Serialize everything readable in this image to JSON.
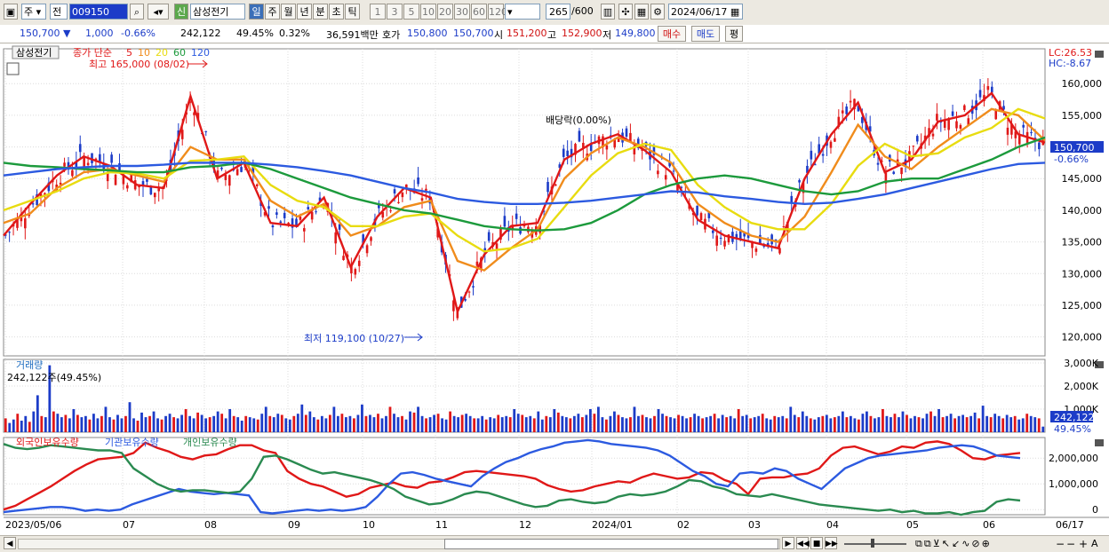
{
  "toolbar": {
    "period_type": "주",
    "prev_label": "전",
    "code": "009150",
    "stock_name": "삼성전기",
    "new_badge": "신",
    "periods": [
      "일",
      "주",
      "월",
      "년",
      "분",
      "초",
      "틱"
    ],
    "active_period": "일",
    "intervals": [
      "1",
      "3",
      "5",
      "10",
      "20",
      "30",
      "60",
      "120"
    ],
    "count": "265",
    "count_total": "/600",
    "date": "2024/06/17"
  },
  "info": {
    "price": "150,700",
    "change": "1,000",
    "change_pct": "-0.66%",
    "volume": "242,122",
    "vol_ratio": "49.45%",
    "turnover_rate": "0.32%",
    "amount": "36,591백만",
    "ask_label": "호가",
    "ask1": "150,800",
    "ask2": "150,700",
    "open_label": "시",
    "open": "151,200",
    "high_label": "고",
    "high": "152,900",
    "low_label": "저",
    "low": "149,800",
    "buy_label": "매수",
    "sell_label": "매도",
    "eval_label": "평"
  },
  "price_panel": {
    "stock_tag": "삼성전기",
    "ma_label": "종가 단순",
    "ma_periods": [
      {
        "label": "5",
        "color": "#e01818"
      },
      {
        "label": "10",
        "color": "#f08c1c"
      },
      {
        "label": "20",
        "color": "#e8dc10"
      },
      {
        "label": "60",
        "color": "#1c9a3c"
      },
      {
        "label": "120",
        "color": "#2c5ae0"
      }
    ],
    "high_annot": "최고 165,000 (08/02)",
    "low_annot": "최저 119,100 (10/27)",
    "div_annot": "배당락(0.00%)",
    "lc": "LC:26.53",
    "hc": "HC:-8.67",
    "current_price": "150,700",
    "current_pct": "-0.66%"
  },
  "volume_panel": {
    "title": "거래량",
    "value": "242,122주(49.45%)",
    "current": "242,122",
    "current_pct": "49.45%"
  },
  "holding_panel": {
    "series_labels": [
      "외국인보유수량",
      "기관보유수량",
      "개인보유수량"
    ]
  },
  "chart_data": [
    {
      "type": "candlestick",
      "title": "삼성전기",
      "x_axis_labels": [
        "2023/05/06",
        "07",
        "08",
        "09",
        "10",
        "11",
        "12",
        "2024/01",
        "02",
        "03",
        "04",
        "05",
        "06",
        "06/17"
      ],
      "y_ticks": [
        120000,
        125000,
        130000,
        135000,
        140000,
        145000,
        150000,
        155000,
        160000
      ],
      "ylim": [
        117000,
        165500
      ],
      "series": [
        {
          "name": "5",
          "color": "#e01818",
          "values": [
            136000,
            141000,
            145500,
            148500,
            147000,
            144000,
            143500,
            158000,
            145000,
            147500,
            138000,
            137500,
            142000,
            131000,
            139000,
            143500,
            142000,
            124000,
            133000,
            137500,
            138000,
            148000,
            150500,
            152000,
            149500,
            146000,
            138500,
            136000,
            135000,
            134000,
            145000,
            152000,
            157000,
            146000,
            148000,
            154000,
            155000,
            158500,
            152000,
            150700
          ]
        },
        {
          "name": "10",
          "color": "#f08c1c",
          "values": [
            138000,
            139500,
            143500,
            146000,
            146500,
            145500,
            144500,
            150000,
            148000,
            148000,
            141500,
            139000,
            141000,
            136000,
            137500,
            140500,
            141500,
            132000,
            130500,
            134000,
            137000,
            145000,
            149000,
            151500,
            150000,
            147500,
            141000,
            138000,
            136000,
            135000,
            139000,
            146000,
            153500,
            148500,
            146500,
            150000,
            153000,
            156000,
            155000,
            151000
          ]
        },
        {
          "name": "20",
          "color": "#e8dc10",
          "values": [
            140000,
            141500,
            143000,
            145000,
            146000,
            145800,
            145000,
            147800,
            148000,
            148500,
            144000,
            141500,
            140500,
            137500,
            137500,
            139000,
            139500,
            136000,
            133500,
            134000,
            135500,
            140500,
            145500,
            149000,
            150500,
            149500,
            144000,
            140500,
            138000,
            137000,
            137000,
            141000,
            147000,
            150500,
            148500,
            149000,
            151500,
            153000,
            156000,
            154500
          ]
        },
        {
          "name": "60",
          "color": "#1c9a3c",
          "values": [
            147500,
            147000,
            146800,
            146500,
            146300,
            146000,
            146000,
            146800,
            147000,
            147500,
            146500,
            145000,
            143500,
            142000,
            141000,
            140000,
            139500,
            138500,
            137500,
            137000,
            136800,
            137000,
            138000,
            140000,
            142500,
            144000,
            145000,
            145500,
            145000,
            144000,
            143000,
            142500,
            143000,
            144500,
            145000,
            145000,
            146500,
            148000,
            150000,
            151500
          ]
        },
        {
          "name": "120",
          "color": "#2c5ae0",
          "values": [
            145500,
            146000,
            146500,
            146800,
            147000,
            147000,
            147200,
            147500,
            147500,
            147500,
            147200,
            146800,
            146200,
            145500,
            144500,
            143500,
            142800,
            141800,
            141300,
            141000,
            141000,
            141200,
            141500,
            142000,
            142500,
            143000,
            142800,
            142200,
            141800,
            141300,
            141000,
            141200,
            141800,
            142500,
            143500,
            144500,
            145500,
            146500,
            147300,
            147500
          ]
        }
      ]
    },
    {
      "type": "bar",
      "title": "거래량",
      "y_ticks_labels": [
        "1,000K",
        "2,000K",
        "3,000K"
      ],
      "ylim": [
        0,
        3000000
      ],
      "values": [
        600000,
        400000,
        550000,
        800000,
        500000,
        700000,
        450000,
        900000,
        1600000,
        700000,
        650000,
        2900000,
        900000,
        800000,
        650000,
        750000,
        600000,
        1000000,
        750000,
        650000,
        700000,
        550000,
        800000,
        600000,
        700000,
        1100000,
        650000,
        550000,
        750000,
        600000,
        700000,
        1300000,
        600000,
        500000,
        850000,
        650000,
        700000,
        900000,
        600000,
        550000,
        700000,
        800000,
        650000,
        600000,
        750000,
        1000000,
        700000,
        600000,
        850000,
        750000,
        600000,
        650000,
        700000,
        900000,
        800000,
        600000,
        1000000,
        700000,
        650000,
        500000,
        700000,
        650000,
        600000,
        550000,
        800000,
        1100000,
        700000,
        650000,
        800000,
        750000,
        600000,
        550000,
        700000,
        800000,
        1200000,
        750000,
        900000,
        650000,
        550000,
        700000,
        600000,
        750000,
        1100000,
        700000,
        800000,
        650000,
        700000,
        600000,
        750000,
        1200000,
        700000,
        750000,
        650000,
        800000,
        600000,
        700000,
        1100000,
        800000,
        650000,
        700000,
        550000,
        900000,
        850000,
        1100000,
        700000,
        600000,
        650000,
        750000,
        800000,
        600000,
        550000,
        900000,
        700000,
        650000,
        750000,
        800000,
        700000,
        600000,
        600000,
        700000,
        550000,
        650000,
        600000,
        750000,
        650000,
        700000,
        650000,
        1000000,
        800000,
        750000,
        650000,
        700000,
        600000,
        900000,
        550000,
        700000,
        650000,
        1000000,
        850000,
        700000,
        650000,
        600000,
        700000,
        800000,
        650000,
        750000,
        1000000,
        800000,
        1100000,
        650000,
        550000,
        700000,
        900000,
        750000,
        650000,
        600000,
        650000,
        1100000,
        700000,
        750000,
        650000,
        600000,
        700000,
        1000000,
        800000,
        700000,
        650000,
        600000,
        750000,
        700000,
        600000,
        650000,
        800000,
        700000,
        600000,
        650000,
        700000,
        800000,
        600000,
        750000,
        650000,
        700000,
        600000,
        1000000,
        700000,
        750000,
        600000,
        650000,
        700000,
        800000,
        600000,
        550000,
        700000,
        650000,
        700000,
        600000,
        1100000,
        750000,
        650000,
        900000,
        700000,
        600000,
        550000,
        650000,
        700000,
        750000,
        600000,
        650000,
        700000,
        900000,
        650000,
        700000,
        600000,
        550000,
        800000,
        900000,
        700000,
        600000,
        650000,
        1000000,
        700000,
        650000,
        800000,
        650000,
        900000,
        750000,
        600000,
        700000,
        650000,
        600000,
        800000,
        900000,
        700000,
        1000000,
        650000,
        700000,
        800000,
        600000,
        700000,
        750000,
        650000,
        700000,
        850000,
        600000,
        1150000,
        700000,
        650000,
        800000,
        700000,
        600000,
        750000,
        650000,
        700000,
        550000,
        600000,
        800000,
        700000,
        650000,
        600000,
        242122
      ]
    },
    {
      "type": "line",
      "title": "보유수량",
      "y_ticks_labels": [
        "0",
        "1,000,000",
        "2,000,000"
      ],
      "ylim": [
        -200000,
        2800000
      ],
      "series": [
        {
          "name": "외국인보유수량",
          "color": "#e01818",
          "values": [
            0,
            150000,
            400000,
            650000,
            900000,
            1200000,
            1500000,
            1750000,
            1950000,
            2000000,
            2050000,
            2200000,
            2600000,
            2400000,
            2250000,
            2050000,
            1950000,
            2100000,
            2150000,
            2350000,
            2500000,
            2500000,
            2300000,
            2200000,
            1500000,
            1200000,
            1000000,
            900000,
            700000,
            500000,
            600000,
            850000,
            950000,
            1050000,
            900000,
            850000,
            1050000,
            1100000,
            1250000,
            1450000,
            1500000,
            1450000,
            1400000,
            1350000,
            1300000,
            1200000,
            950000,
            800000,
            700000,
            750000,
            900000,
            1000000,
            1100000,
            1050000,
            1250000,
            1400000,
            1300000,
            1200000,
            1250000,
            1450000,
            1400000,
            1150000,
            1000000,
            600000,
            1200000,
            1250000,
            1250000,
            1350000,
            1400000,
            1600000,
            2100000,
            2400000,
            2450000,
            2300000,
            2150000,
            2250000,
            2450000,
            2400000,
            2600000,
            2650000,
            2550000,
            2300000,
            2000000,
            1950000,
            2100000,
            2150000,
            2200000
          ]
        },
        {
          "name": "기관보유수량",
          "color": "#2c5ae0",
          "values": [
            -100000,
            -50000,
            0,
            50000,
            100000,
            100000,
            50000,
            -50000,
            0,
            -50000,
            0,
            200000,
            350000,
            500000,
            650000,
            800000,
            700000,
            650000,
            600000,
            650000,
            600000,
            550000,
            -100000,
            -150000,
            -100000,
            -50000,
            0,
            -50000,
            0,
            -50000,
            0,
            100000,
            500000,
            1000000,
            1400000,
            1450000,
            1350000,
            1200000,
            1100000,
            1000000,
            900000,
            1300000,
            1600000,
            1850000,
            2000000,
            2200000,
            2350000,
            2450000,
            2600000,
            2650000,
            2700000,
            2650000,
            2550000,
            2500000,
            2450000,
            2400000,
            2300000,
            2100000,
            1800000,
            1500000,
            1300000,
            1000000,
            900000,
            1400000,
            1450000,
            1400000,
            1600000,
            1500000,
            1200000,
            1000000,
            800000,
            1200000,
            1600000,
            1800000,
            2000000,
            2100000,
            2150000,
            2200000,
            2250000,
            2300000,
            2400000,
            2450000,
            2500000,
            2450000,
            2300000,
            2100000,
            2050000,
            2000000
          ]
        },
        {
          "name": "개인보유수량",
          "color": "#2a8a50",
          "values": [
            2550000,
            2400000,
            2350000,
            2400000,
            2500000,
            2450000,
            2400000,
            2350000,
            2300000,
            2300000,
            2200000,
            1600000,
            1300000,
            1000000,
            800000,
            700000,
            750000,
            750000,
            700000,
            650000,
            700000,
            1200000,
            2050000,
            2100000,
            1950000,
            1750000,
            1550000,
            1400000,
            1450000,
            1350000,
            1250000,
            1150000,
            1000000,
            800000,
            500000,
            350000,
            200000,
            250000,
            400000,
            600000,
            700000,
            650000,
            500000,
            350000,
            200000,
            100000,
            150000,
            350000,
            400000,
            300000,
            250000,
            300000,
            500000,
            600000,
            550000,
            600000,
            700000,
            900000,
            1150000,
            1100000,
            900000,
            800000,
            600000,
            550000,
            500000,
            600000,
            500000,
            400000,
            300000,
            200000,
            150000,
            100000,
            50000,
            0,
            -50000,
            0,
            -100000,
            -50000,
            -150000,
            -150000,
            -100000,
            -200000,
            -100000,
            -50000,
            300000,
            400000,
            350000
          ]
        }
      ]
    }
  ]
}
